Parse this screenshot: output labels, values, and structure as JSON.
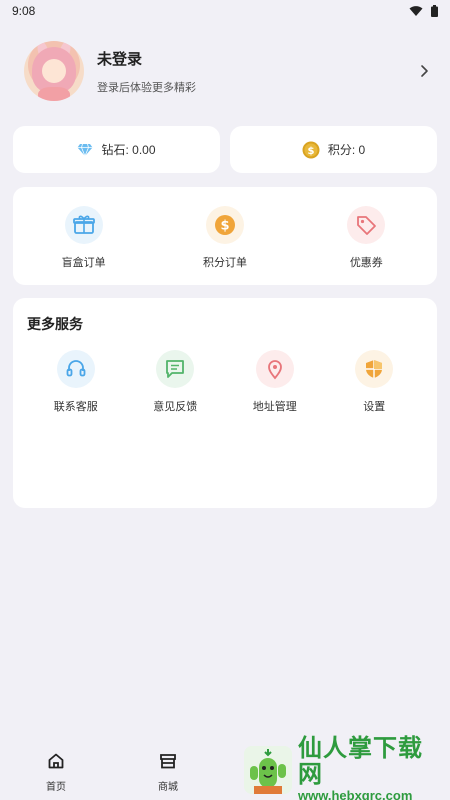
{
  "status": {
    "time": "9:08",
    "wifi_icon": "wifi-icon",
    "battery_icon": "battery-icon"
  },
  "profile": {
    "name": "未登录",
    "subtitle": "登录后体验更多精彩"
  },
  "balance": {
    "diamond_label": "钻石: 0.00",
    "points_label": "积分: 0"
  },
  "orders": [
    {
      "label": "盲盒订单",
      "icon": "gift-box-icon",
      "color": "#4aa6e8"
    },
    {
      "label": "积分订单",
      "icon": "coin-icon",
      "color": "#f0a53a"
    },
    {
      "label": "优惠券",
      "icon": "tag-icon",
      "color": "#e8757a"
    }
  ],
  "services": {
    "title": "更多服务",
    "items": [
      {
        "label": "联系客服",
        "icon": "headset-icon",
        "color": "#4aa6e8"
      },
      {
        "label": "意见反馈",
        "icon": "message-icon",
        "color": "#52b46a"
      },
      {
        "label": "地址管理",
        "icon": "location-pin-icon",
        "color": "#e8757a"
      },
      {
        "label": "设置",
        "icon": "shield-icon",
        "color": "#f0a53a"
      }
    ]
  },
  "tabbar": [
    {
      "label": "首页",
      "icon": "home-icon"
    },
    {
      "label": "商城",
      "icon": "store-icon"
    }
  ],
  "watermark": {
    "title": "仙人掌下载网",
    "url": "www.hebxqrc.com"
  }
}
